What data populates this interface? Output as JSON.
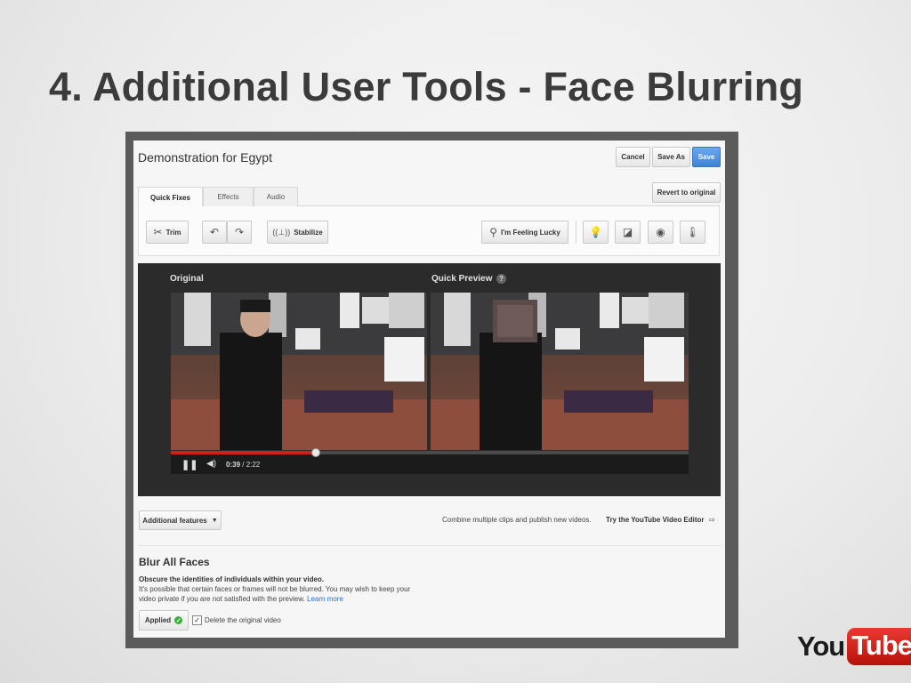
{
  "slide": {
    "title": "4. Additional User Tools - Face Blurring"
  },
  "editor": {
    "video_title": "Demonstration for Egypt",
    "header_buttons": {
      "cancel": "Cancel",
      "save_as": "Save As",
      "save": "Save"
    },
    "revert_label": "Revert to original",
    "tabs": [
      {
        "label": "Quick Fixes",
        "active": true
      },
      {
        "label": "Effects",
        "active": false
      },
      {
        "label": "Audio",
        "active": false
      }
    ],
    "tools": {
      "trim": "Trim",
      "stabilize": "Stabilize",
      "feeling_lucky": "I'm Feeling Lucky"
    },
    "player": {
      "original_label": "Original",
      "preview_label": "Quick Preview",
      "help_glyph": "?",
      "current_time": "0:39",
      "time_separator": " / ",
      "total_time": "2:22",
      "progress_fraction": 0.28
    },
    "additional_features_label": "Additional features",
    "combine_text": "Combine multiple clips and publish new videos.",
    "video_editor_link": "Try the YouTube Video Editor",
    "blur": {
      "heading": "Blur All Faces",
      "subheading": "Obscure the identities of individuals within your video.",
      "description_line1": "It's possible that certain faces or frames will not be blurred. You may wish to keep your",
      "description_line2": "video private if you are not satisfied with the preview. ",
      "learn_more": "Learn more",
      "applied_label": "Applied",
      "delete_original_label": "Delete the original video",
      "delete_original_checked": true
    }
  },
  "branding": {
    "logo_you": "You",
    "logo_tube": "Tube"
  },
  "colors": {
    "accent_blue": "#3e83d6",
    "progress_red": "#d21e1e",
    "applied_green": "#3cae3c",
    "youtube_red": "#cc1f16"
  }
}
